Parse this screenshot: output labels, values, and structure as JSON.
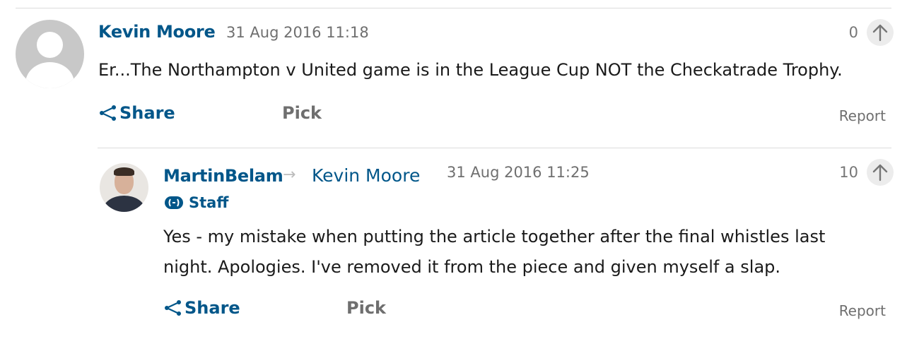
{
  "comments": [
    {
      "author": "Kevin Moore",
      "timestamp": "31 Aug 2016 11:18",
      "recommend_count": "0",
      "body": "Er...The Northampton v United game is in the League Cup NOT the Checkatrade Trophy.",
      "share_label": "Share",
      "pick_label": "Pick",
      "report_label": "Report"
    }
  ],
  "reply": {
    "author": "MartinBelam",
    "reply_to": "Kevin Moore",
    "badge": "Staff",
    "timestamp": "31 Aug 2016 11:25",
    "recommend_count": "10",
    "body_line1": "Yes - my mistake when putting the article together after the final whistles last",
    "body_line2": "night. Apologies. I've removed it from the piece and given myself a slap.",
    "share_label": "Share",
    "pick_label": "Pick",
    "report_label": "Report"
  },
  "colors": {
    "link": "#005689",
    "muted": "#6f6f6f",
    "divider": "#dcdcdc"
  },
  "icons": {
    "share": "share-icon",
    "recommend": "arrow-up-icon",
    "reply_arrow": "arrow-right-icon",
    "staff": "guardian-staff-icon"
  }
}
